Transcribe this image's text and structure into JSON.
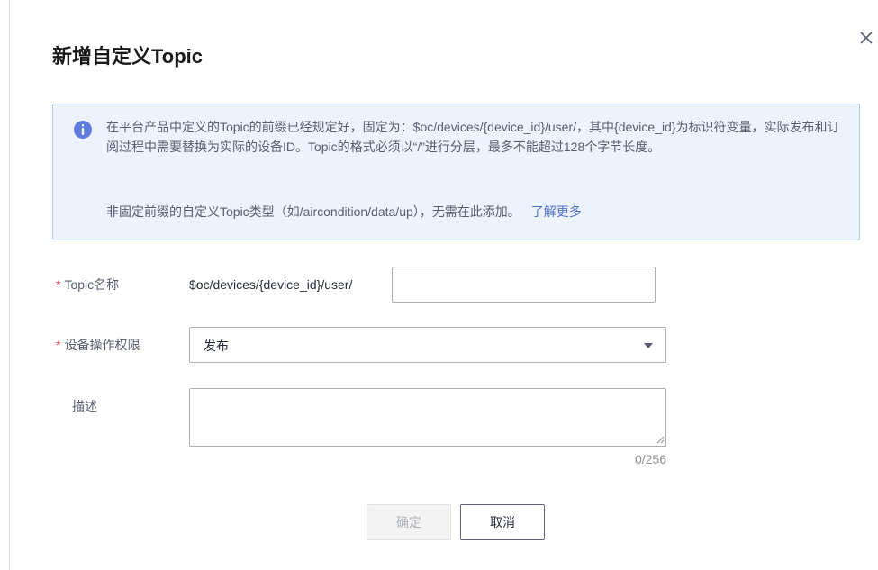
{
  "dialog": {
    "title": "新增自定义Topic",
    "close_label": "×"
  },
  "info": {
    "paragraph1": "在平台产品中定义的Topic的前缀已经规定好，固定为：$oc/devices/{device_id}/user/，其中{device_id}为标识符变量，实际发布和订阅过程中需要替换为实际的设备ID。Topic的格式必须以“/”进行分层，最多不能超过128个字节长度。",
    "paragraph2": "非固定前缀的自定义Topic类型（如/aircondition/data/up），无需在此添加。",
    "learn_more": "了解更多"
  },
  "form": {
    "required_mark": "*",
    "topic_name_label": "Topic名称",
    "topic_prefix": "$oc/devices/{device_id}/user/",
    "topic_name_value": "",
    "permission_label": "设备操作权限",
    "permission_value": "发布",
    "description_label": "描述",
    "description_value": "",
    "description_counter": "0/256"
  },
  "buttons": {
    "ok": "确定",
    "cancel": "取消"
  },
  "colors": {
    "accent": "#526ecc",
    "required": "#e6484f",
    "info_bg": "#edf3fd",
    "info_border": "#b0ccf5",
    "info_icon": "#5e7ce0"
  },
  "icons": {
    "close": "close-icon",
    "info": "info-icon",
    "dropdown": "caret-down-icon",
    "resize": "resize-grip-icon"
  }
}
